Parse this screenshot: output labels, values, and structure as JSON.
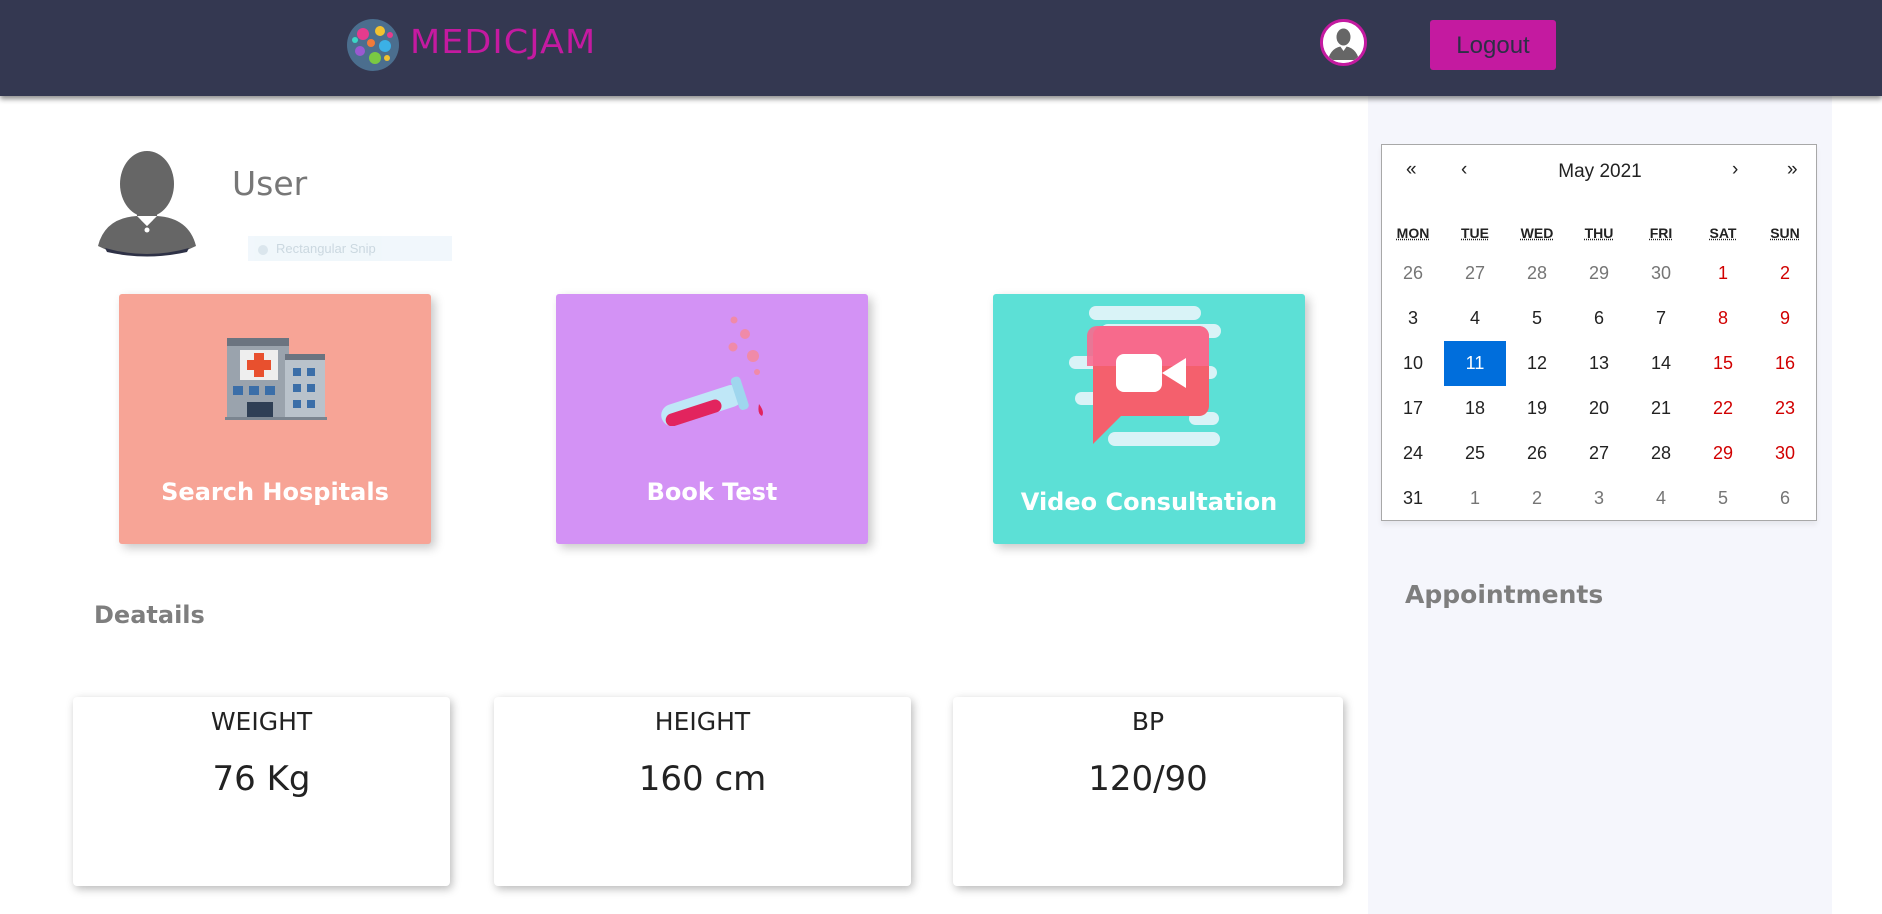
{
  "header": {
    "brand": "MEDICJAM",
    "logout_label": "Logout"
  },
  "user": {
    "name": "User",
    "snip_label": "Rectangular Snip"
  },
  "cards": [
    {
      "label": "Search Hospitals",
      "color": "#f7a496",
      "icon": "hospital-icon"
    },
    {
      "label": "Book Test",
      "color": "#d392f5",
      "icon": "test-tube-icon"
    },
    {
      "label": "Video Consultation",
      "color": "#5ce0d6",
      "icon": "video-chat-icon"
    }
  ],
  "details": {
    "title": "Deatails",
    "stats": [
      {
        "label": "WEIGHT",
        "value": "76 Kg"
      },
      {
        "label": "HEIGHT",
        "value": "160 cm"
      },
      {
        "label": "BP",
        "value": "120/90"
      }
    ]
  },
  "calendar": {
    "prev_year": "«",
    "prev_month": "‹",
    "title": "May 2021",
    "next_month": "›",
    "next_year": "»",
    "weekdays": [
      "MON",
      "TUE",
      "WED",
      "THU",
      "FRI",
      "SAT",
      "SUN"
    ],
    "selected_day": "11",
    "weeks": [
      [
        "26",
        "27",
        "28",
        "29",
        "30",
        "1",
        "2"
      ],
      [
        "3",
        "4",
        "5",
        "6",
        "7",
        "8",
        "9"
      ],
      [
        "10",
        "11",
        "12",
        "13",
        "14",
        "15",
        "16"
      ],
      [
        "17",
        "18",
        "19",
        "20",
        "21",
        "22",
        "23"
      ],
      [
        "24",
        "25",
        "26",
        "27",
        "28",
        "29",
        "30"
      ],
      [
        "31",
        "1",
        "2",
        "3",
        "4",
        "5",
        "6"
      ]
    ]
  },
  "appointments": {
    "title": "Appointments"
  },
  "colors": {
    "header_bg": "#343851",
    "accent": "#c41aa0",
    "selected_day": "#006edc",
    "weekend": "#d10000"
  }
}
